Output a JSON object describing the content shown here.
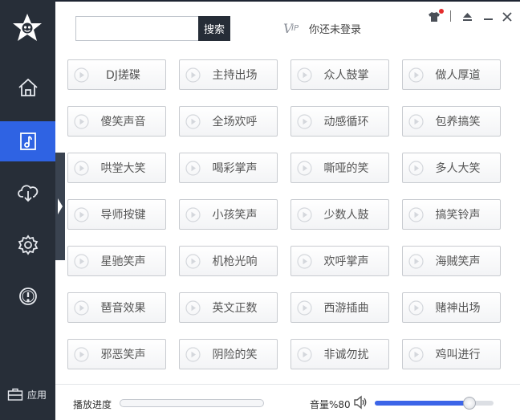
{
  "search": {
    "placeholder": "",
    "value": "",
    "button_label": "搜索"
  },
  "header": {
    "login_text": "你还未登录",
    "vip_icon": "vip-icon"
  },
  "window_controls": [
    "skin-icon",
    "collapse-up-icon",
    "minimize-icon",
    "close-icon"
  ],
  "sidebar": {
    "items": [
      {
        "name": "home",
        "icon": "house-icon",
        "active": false
      },
      {
        "name": "music-library",
        "icon": "music-note-icon",
        "active": true
      },
      {
        "name": "cloud-download",
        "icon": "cloud-download-icon",
        "active": false
      },
      {
        "name": "settings",
        "icon": "gear-icon",
        "active": false
      },
      {
        "name": "about",
        "icon": "exclamation-icon",
        "active": false
      }
    ],
    "app_label": "应用"
  },
  "sounds": [
    [
      "DJ搓碟",
      "主持出场",
      "众人鼓掌",
      "做人厚道"
    ],
    [
      "傻笑声音",
      "全场欢呼",
      "动感循环",
      "包养搞笑"
    ],
    [
      "哄堂大笑",
      "喝彩掌声",
      "嘶哑的笑",
      "多人大笑"
    ],
    [
      "导师按键",
      "小孩笑声",
      "少数人鼓",
      "搞笑铃声"
    ],
    [
      "星驰笑声",
      "机枪光响",
      "欢呼掌声",
      "海贼笑声"
    ],
    [
      "琶音效果",
      "英文正数",
      "西游插曲",
      "赌神出场"
    ],
    [
      "邪恶笑声",
      "阴险的笑",
      "非诚勿扰",
      "鸡叫进行"
    ]
  ],
  "footer": {
    "progress_label": "播放进度",
    "progress": 0,
    "volume_label": "音量%80",
    "volume": 0.8
  },
  "colors": {
    "sidebar": "#272e38",
    "accent": "#2f63e3",
    "dark_button": "#262d37",
    "red_dot": "#e42b2b"
  }
}
